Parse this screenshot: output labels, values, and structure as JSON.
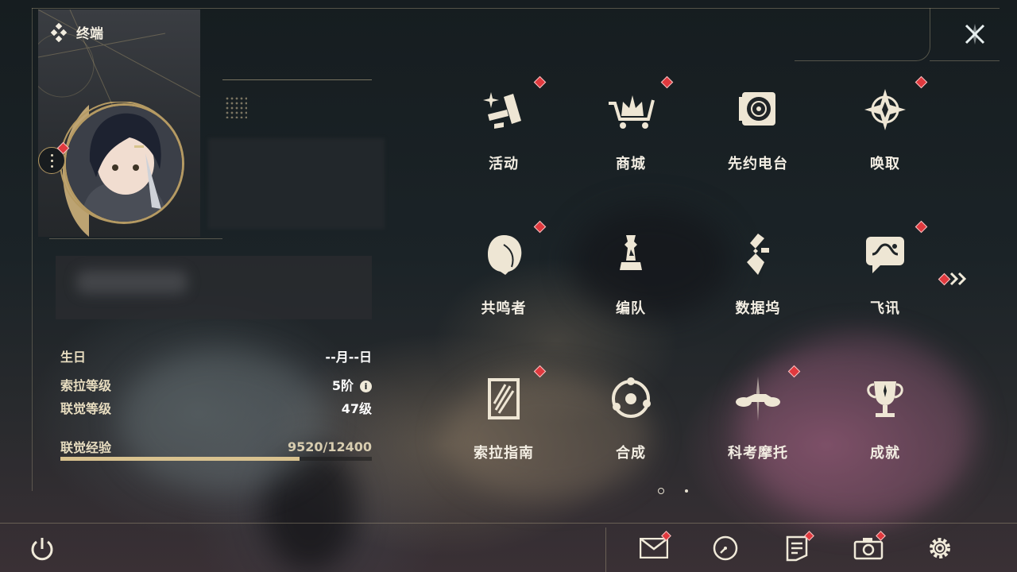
{
  "header": {
    "title": "终端"
  },
  "profile": {
    "birthday_label": "生日",
    "birthday_value": "--月--日",
    "sola_level_label": "索拉等级",
    "sola_level_value": "5阶",
    "union_level_label": "联觉等级",
    "union_level_value": "47级",
    "union_exp_label": "联觉经验",
    "union_exp_value": "9520/12400",
    "union_exp_progress": 0.7677,
    "info_icon_glyph": "i"
  },
  "menu": {
    "items": [
      {
        "label": "活动",
        "icon": "sparkle-activity-icon",
        "badge": true
      },
      {
        "label": "商城",
        "icon": "shop-cart-icon",
        "badge": true
      },
      {
        "label": "先约电台",
        "icon": "radio-record-icon",
        "badge": false
      },
      {
        "label": "唤取",
        "icon": "compass-star-icon",
        "badge": true
      },
      {
        "label": "共鸣者",
        "icon": "resonator-head-icon",
        "badge": true
      },
      {
        "label": "编队",
        "icon": "chess-formation-icon",
        "badge": false
      },
      {
        "label": "数据坞",
        "icon": "data-dock-icon",
        "badge": false
      },
      {
        "label": "飞讯",
        "icon": "chat-bubble-icon",
        "badge": true
      },
      {
        "label": "索拉指南",
        "icon": "guide-book-icon",
        "badge": true
      },
      {
        "label": "合成",
        "icon": "synthesis-orbit-icon",
        "badge": false
      },
      {
        "label": "科考摩托",
        "icon": "motorbike-icon",
        "badge": true
      },
      {
        "label": "成就",
        "icon": "trophy-icon",
        "badge": false
      }
    ]
  },
  "pager": {
    "current": 1,
    "total": 2
  },
  "bottom_bar": {
    "items": [
      {
        "name": "mail",
        "icon": "mail-icon",
        "badge": true
      },
      {
        "name": "clock",
        "icon": "clock-icon",
        "badge": false
      },
      {
        "name": "notice",
        "icon": "notice-icon",
        "badge": true
      },
      {
        "name": "camera",
        "icon": "camera-icon",
        "badge": true
      },
      {
        "name": "settings",
        "icon": "gear-icon",
        "badge": false
      }
    ]
  },
  "colors": {
    "accent_gold": "#b59a63",
    "badge_red": "#e0393e",
    "text_primary": "#f3eee3",
    "xp_fill": "#d9c28f"
  }
}
